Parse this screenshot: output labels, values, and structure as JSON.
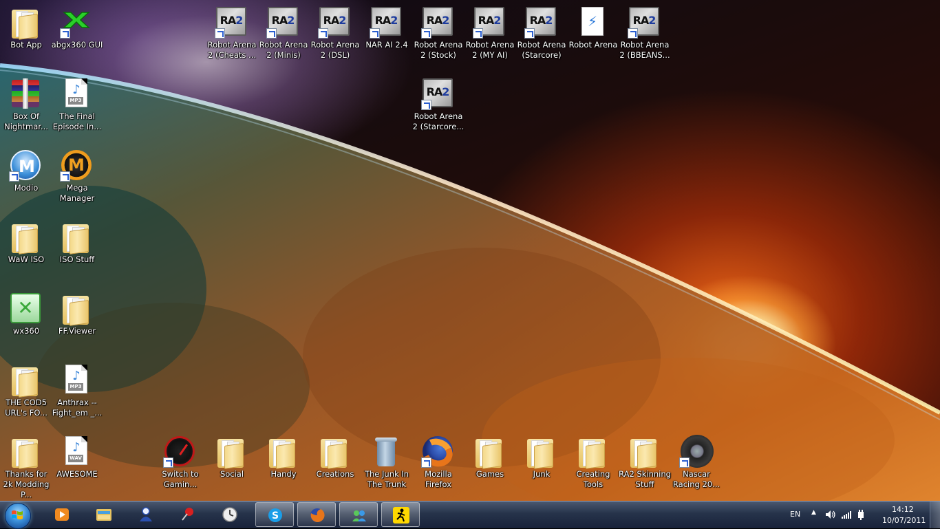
{
  "desktop": {
    "icons": [
      {
        "label": "Bot App",
        "type": "folder"
      },
      {
        "label": "abgx360 GUI",
        "type": "abgx"
      },
      {
        "label": "Box Of Nightmar...",
        "type": "winrar"
      },
      {
        "label": "The Final Episode In...",
        "type": "mp3"
      },
      {
        "label": "Modio",
        "type": "modio"
      },
      {
        "label": "Mega Manager",
        "type": "mega"
      },
      {
        "label": "WaW ISO",
        "type": "folder"
      },
      {
        "label": "ISO Stuff",
        "type": "folder"
      },
      {
        "label": "wx360",
        "type": "xbox"
      },
      {
        "label": "FF.Viewer",
        "type": "folder"
      },
      {
        "label": "THE COD5 URL's FO...",
        "type": "folder"
      },
      {
        "label": "Anthrax -- Fight_em _...",
        "type": "mp3"
      },
      {
        "label": "Thanks for 2k Modding P...",
        "type": "folder"
      },
      {
        "label": "AWESOME",
        "type": "wav"
      },
      {
        "label": "Robot Arena 2 (Cheats ...",
        "type": "ra2"
      },
      {
        "label": "Robot Arena 2 (Minis)",
        "type": "ra2"
      },
      {
        "label": "Robot Arena 2 (DSL)",
        "type": "ra2"
      },
      {
        "label": "NAR AI 2.4",
        "type": "ra2"
      },
      {
        "label": "Robot Arena 2 (Stock)",
        "type": "ra2"
      },
      {
        "label": "Robot Arena 2 (MY AI)",
        "type": "ra2"
      },
      {
        "label": "Robot Arena (Starcore)",
        "type": "ra2"
      },
      {
        "label": "Robot Arena",
        "type": "doc"
      },
      {
        "label": "Robot Arena 2 (BBEANS...",
        "type": "ra2"
      },
      {
        "label": "Robot Arena 2 (Starcore...",
        "type": "ra2"
      },
      {
        "label": "Switch to Gamin...",
        "type": "speed"
      },
      {
        "label": "Social",
        "type": "folder"
      },
      {
        "label": "Handy",
        "type": "folder"
      },
      {
        "label": "Creations",
        "type": "folder"
      },
      {
        "label": "The Junk In The Trunk",
        "type": "trash"
      },
      {
        "label": "Mozilla Firefox",
        "type": "firefox"
      },
      {
        "label": "Games",
        "type": "folder"
      },
      {
        "label": "Junk",
        "type": "folder"
      },
      {
        "label": "Creating Tools",
        "type": "folder"
      },
      {
        "label": "RA2 Skinning Stuff",
        "type": "folder"
      },
      {
        "label": "Nascar Racing 20...",
        "type": "tire"
      }
    ]
  },
  "taskbar": {
    "start_icon": "windows-start-orb",
    "pinned": [
      {
        "name": "windows-media-player",
        "icon": "media-player-icon"
      },
      {
        "name": "windows-explorer",
        "icon": "explorer-icon"
      },
      {
        "name": "messenger",
        "icon": "messenger-icon"
      },
      {
        "name": "pin-app",
        "icon": "pushpin-icon"
      },
      {
        "name": "clock-app",
        "icon": "clock-icon"
      },
      {
        "name": "skype",
        "icon": "skype-icon"
      },
      {
        "name": "firefox",
        "icon": "firefox-icon"
      },
      {
        "name": "live-messenger",
        "icon": "live-messenger-icon"
      },
      {
        "name": "aim",
        "icon": "aim-running-man-icon"
      }
    ],
    "tray": {
      "language": "EN",
      "time": "14:12",
      "date": "10/07/2011"
    }
  },
  "colors": {
    "taskbar": "#26334a",
    "label_text": "#ffffff"
  }
}
